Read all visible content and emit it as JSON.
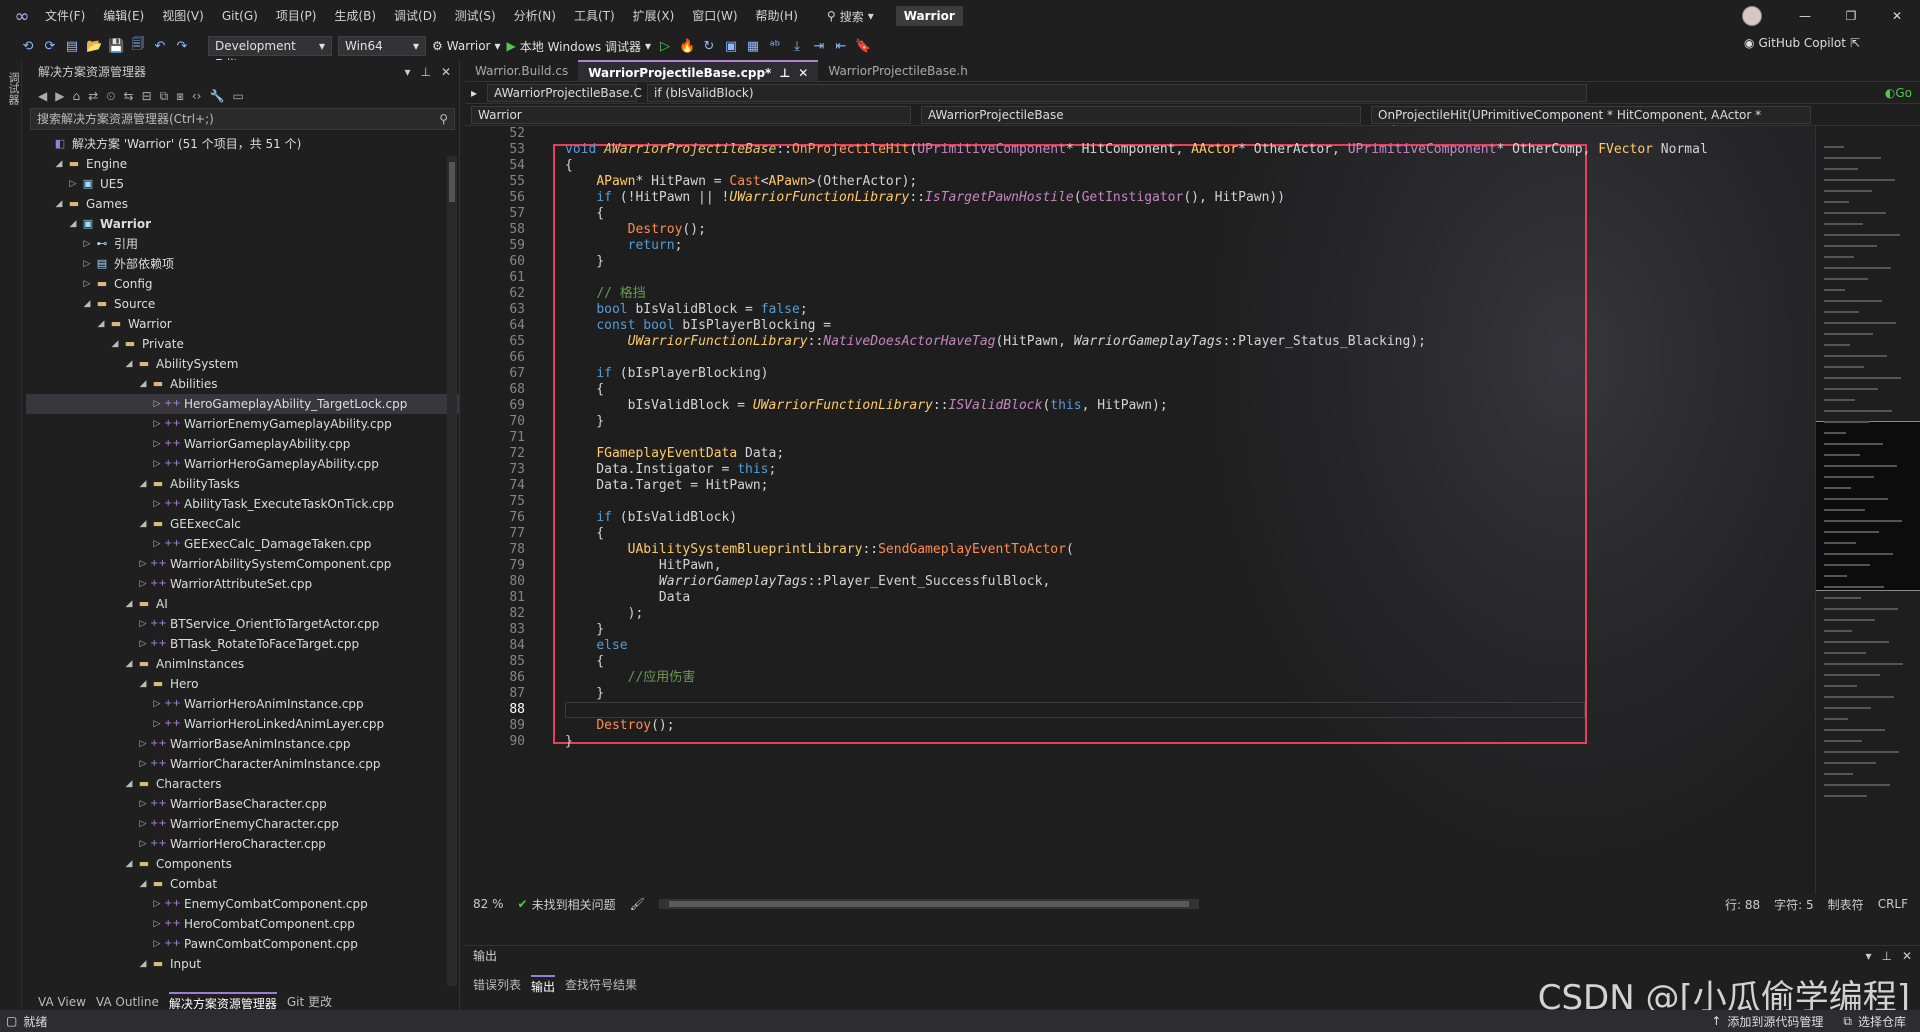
{
  "menubar": {
    "items": [
      "文件(F)",
      "编辑(E)",
      "视图(V)",
      "Git(G)",
      "项目(P)",
      "生成(B)",
      "调试(D)",
      "测试(S)",
      "分析(N)",
      "工具(T)",
      "扩展(X)",
      "窗口(W)",
      "帮助(H)"
    ],
    "search_label": "搜索",
    "solution_name": "Warrior",
    "window_buttons": [
      "—",
      "❐",
      "✕"
    ]
  },
  "toolbar": {
    "config": "Development Editor",
    "platform": "Win64",
    "project": "Warrior",
    "debugger": "本地 Windows 调试器",
    "copilot": "GitHub Copilot"
  },
  "leftstrip": {
    "label": "调试器"
  },
  "solution_explorer": {
    "title": "解决方案资源管理器",
    "search_placeholder": "搜索解决方案资源管理器(Ctrl+;)",
    "tree": [
      {
        "label": "解决方案 'Warrior' (51 个项目，共 51 个)",
        "icon": "solution-icon",
        "arrow": "",
        "depth": 0
      },
      {
        "label": "Engine",
        "icon": "folder-icon",
        "arrow": "◢",
        "depth": 1
      },
      {
        "label": "UE5",
        "icon": "project-icon",
        "arrow": "▷",
        "depth": 2
      },
      {
        "label": "Games",
        "icon": "folder-icon",
        "arrow": "◢",
        "depth": 1
      },
      {
        "label": "Warrior",
        "icon": "project-icon",
        "arrow": "◢",
        "depth": 2,
        "bold": true
      },
      {
        "label": "引用",
        "icon": "reference-icon",
        "arrow": "▷",
        "depth": 3
      },
      {
        "label": "外部依赖项",
        "icon": "dependency-icon",
        "arrow": "▷",
        "depth": 3
      },
      {
        "label": "Config",
        "icon": "folder-icon",
        "arrow": "▷",
        "depth": 3
      },
      {
        "label": "Source",
        "icon": "folder-icon",
        "arrow": "◢",
        "depth": 3
      },
      {
        "label": "Warrior",
        "icon": "folder-icon",
        "arrow": "◢",
        "depth": 4
      },
      {
        "label": "Private",
        "icon": "folder-icon",
        "arrow": "◢",
        "depth": 5
      },
      {
        "label": "AbilitySystem",
        "icon": "folder-icon",
        "arrow": "◢",
        "depth": 6
      },
      {
        "label": "Abilities",
        "icon": "folder-icon",
        "arrow": "◢",
        "depth": 7
      },
      {
        "label": "HeroGameplayAbility_TargetLock.cpp",
        "icon": "cpp-file-icon",
        "arrow": "▷",
        "depth": 8,
        "selected": true
      },
      {
        "label": "WarriorEnemyGameplayAbility.cpp",
        "icon": "cpp-file-icon",
        "arrow": "▷",
        "depth": 8
      },
      {
        "label": "WarriorGameplayAbility.cpp",
        "icon": "cpp-file-icon",
        "arrow": "▷",
        "depth": 8
      },
      {
        "label": "WarriorHeroGameplayAbility.cpp",
        "icon": "cpp-file-icon",
        "arrow": "▷",
        "depth": 8
      },
      {
        "label": "AbilityTasks",
        "icon": "folder-icon",
        "arrow": "◢",
        "depth": 7
      },
      {
        "label": "AbilityTask_ExecuteTaskOnTick.cpp",
        "icon": "cpp-file-icon",
        "arrow": "▷",
        "depth": 8
      },
      {
        "label": "GEExecCalc",
        "icon": "folder-icon",
        "arrow": "◢",
        "depth": 7
      },
      {
        "label": "GEExecCalc_DamageTaken.cpp",
        "icon": "cpp-file-icon",
        "arrow": "▷",
        "depth": 8
      },
      {
        "label": "WarriorAbilitySystemComponent.cpp",
        "icon": "cpp-file-icon",
        "arrow": "▷",
        "depth": 7
      },
      {
        "label": "WarriorAttributeSet.cpp",
        "icon": "cpp-file-icon",
        "arrow": "▷",
        "depth": 7
      },
      {
        "label": "AI",
        "icon": "folder-icon",
        "arrow": "◢",
        "depth": 6
      },
      {
        "label": "BTService_OrientToTargetActor.cpp",
        "icon": "cpp-file-icon",
        "arrow": "▷",
        "depth": 7
      },
      {
        "label": "BTTask_RotateToFaceTarget.cpp",
        "icon": "cpp-file-icon",
        "arrow": "▷",
        "depth": 7
      },
      {
        "label": "AnimInstances",
        "icon": "folder-icon",
        "arrow": "◢",
        "depth": 6
      },
      {
        "label": "Hero",
        "icon": "folder-icon",
        "arrow": "◢",
        "depth": 7
      },
      {
        "label": "WarriorHeroAnimInstance.cpp",
        "icon": "cpp-file-icon",
        "arrow": "▷",
        "depth": 8
      },
      {
        "label": "WarriorHeroLinkedAnimLayer.cpp",
        "icon": "cpp-file-icon",
        "arrow": "▷",
        "depth": 8
      },
      {
        "label": "WarriorBaseAnimInstance.cpp",
        "icon": "cpp-file-icon",
        "arrow": "▷",
        "depth": 7
      },
      {
        "label": "WarriorCharacterAnimInstance.cpp",
        "icon": "cpp-file-icon",
        "arrow": "▷",
        "depth": 7
      },
      {
        "label": "Characters",
        "icon": "folder-icon",
        "arrow": "◢",
        "depth": 6
      },
      {
        "label": "WarriorBaseCharacter.cpp",
        "icon": "cpp-file-icon",
        "arrow": "▷",
        "depth": 7
      },
      {
        "label": "WarriorEnemyCharacter.cpp",
        "icon": "cpp-file-icon",
        "arrow": "▷",
        "depth": 7
      },
      {
        "label": "WarriorHeroCharacter.cpp",
        "icon": "cpp-file-icon",
        "arrow": "▷",
        "depth": 7
      },
      {
        "label": "Components",
        "icon": "folder-icon",
        "arrow": "◢",
        "depth": 6
      },
      {
        "label": "Combat",
        "icon": "folder-icon",
        "arrow": "◢",
        "depth": 7
      },
      {
        "label": "EnemyCombatComponent.cpp",
        "icon": "cpp-file-icon",
        "arrow": "▷",
        "depth": 8
      },
      {
        "label": "HeroCombatComponent.cpp",
        "icon": "cpp-file-icon",
        "arrow": "▷",
        "depth": 8
      },
      {
        "label": "PawnCombatComponent.cpp",
        "icon": "cpp-file-icon",
        "arrow": "▷",
        "depth": 8
      },
      {
        "label": "Input",
        "icon": "folder-icon",
        "arrow": "◢",
        "depth": 7
      }
    ],
    "bottom_tabs": [
      "VA View",
      "VA Outline",
      "解决方案资源管理器",
      "Git 更改"
    ],
    "active_bottom_tab": 2
  },
  "editor": {
    "tabs": [
      "Warrior.Build.cs",
      "WarriorProjectileBase.cpp*",
      "WarriorProjectileBase.h"
    ],
    "active_tab": 1,
    "nav_left": "AWarriorProjectileBase.C",
    "nav_mid": "if (bIsValidBlock)",
    "nav_go": "Go",
    "scope_project": "Warrior",
    "scope_class": "AWarriorProjectileBase",
    "scope_member": "OnProjectileHit(UPrimitiveComponent * HitComponent, AActor * OtherA",
    "current_line": 88,
    "first_line": 52
  },
  "status_line": {
    "zoom": "82 %",
    "issues": "未找到相关问题",
    "line": "行: 88",
    "char": "字符: 5",
    "tabs": "制表符",
    "eol": "CRLF"
  },
  "output": {
    "title": "输出",
    "tabs": [
      "错误列表",
      "输出",
      "查找符号结果"
    ],
    "active_tab": 1
  },
  "statusbar": {
    "ready": "就绪",
    "add_source": "添加到源代码管理",
    "select_repo": "选择仓库"
  },
  "watermark": "CSDN @[小瓜偷学编程]",
  "colors": {
    "accent": "#b180d7",
    "selection_border": "#e8405a",
    "keyword": "#569cd6",
    "comment": "#6a9955"
  }
}
